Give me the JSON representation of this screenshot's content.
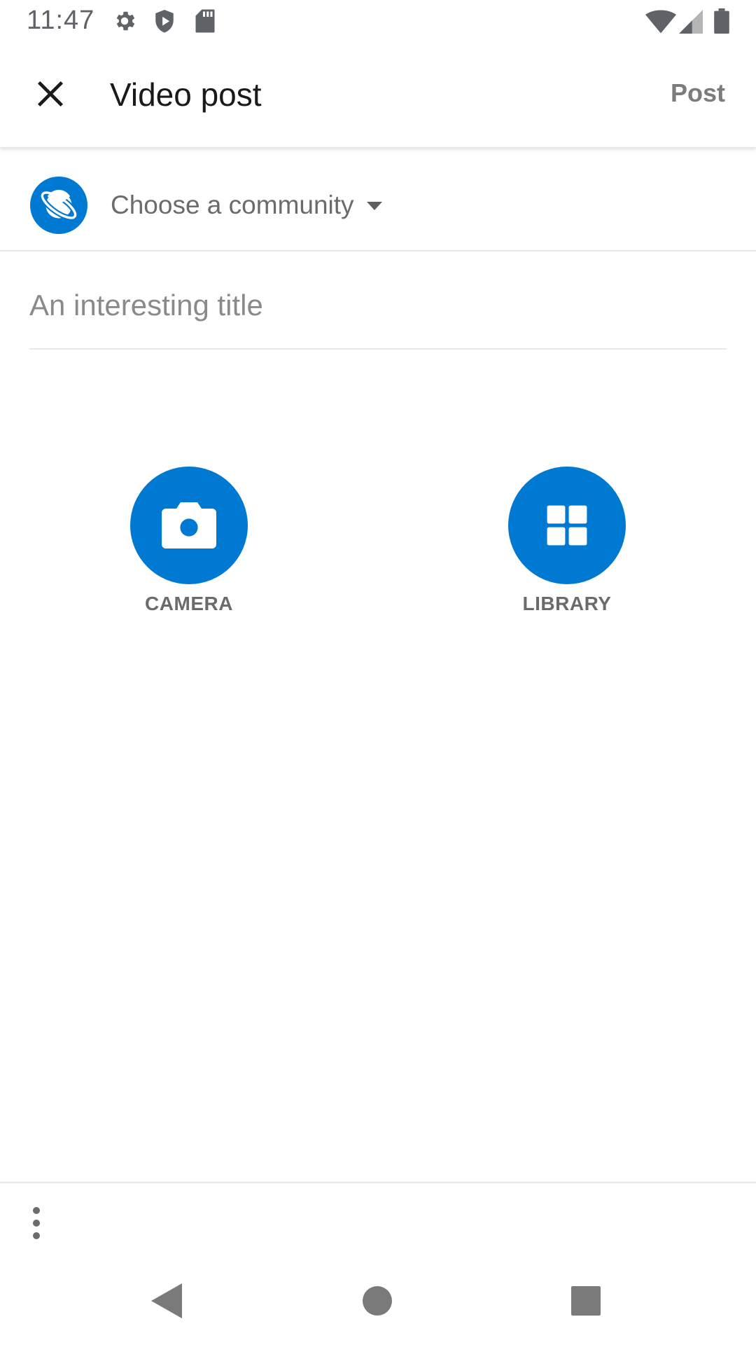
{
  "status_bar": {
    "time": "11:47",
    "left_icons": [
      "gear-icon",
      "shield-play-icon",
      "sd-card-icon"
    ],
    "right_icons": [
      "wifi-icon",
      "cell-signal-icon",
      "battery-icon"
    ]
  },
  "app_bar": {
    "title": "Video post",
    "close_icon": "close-icon",
    "post_label": "Post"
  },
  "community": {
    "label": "Choose a community",
    "avatar_icon": "planet-icon",
    "caret_icon": "caret-down-icon"
  },
  "title_field": {
    "placeholder": "An interesting title",
    "value": ""
  },
  "media": {
    "camera_label": "CAMERA",
    "library_label": "LIBRARY"
  },
  "colors": {
    "accent": "#0079d3",
    "muted_text": "#6b6b6b",
    "placeholder": "#8a8a8a"
  },
  "bottom_bar": {
    "more_icon": "more-vertical-icon"
  },
  "nav_bar": {
    "icons": [
      "back-icon",
      "home-icon",
      "recents-icon"
    ]
  }
}
